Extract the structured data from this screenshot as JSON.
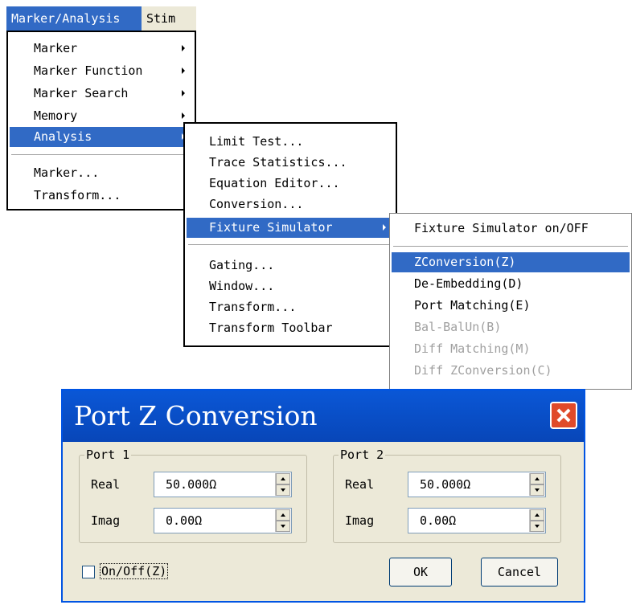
{
  "menubar": {
    "active_label": "Marker/Analysis",
    "next_label": "Stim"
  },
  "marker_menu": {
    "items": [
      "Marker",
      "Marker Function",
      "Marker Search",
      "Memory",
      "Analysis",
      "Marker...",
      "Transform..."
    ]
  },
  "analysis_menu": {
    "items": [
      "Limit Test...",
      "Trace Statistics...",
      "Equation Editor...",
      "Conversion...",
      "Fixture Simulator",
      "Gating...",
      "Window...",
      "Transform...",
      "Transform Toolbar"
    ]
  },
  "fixture_menu": {
    "items": [
      "Fixture Simulator on/OFF",
      "ZConversion(Z)",
      "De-Embedding(D)",
      "Port Matching(E)",
      "Bal-BalUn(B)",
      "Diff Matching(M)",
      "Diff ZConversion(C)"
    ]
  },
  "dialog": {
    "title": "Port Z Conversion",
    "port1": {
      "legend": "Port 1",
      "real_label": "Real",
      "real_value": "50.000Ω",
      "imag_label": "Imag",
      "imag_value": "0.00Ω"
    },
    "port2": {
      "legend": "Port 2",
      "real_label": "Real",
      "real_value": "50.000Ω",
      "imag_label": "Imag",
      "imag_value": "0.00Ω"
    },
    "onoff_label": "On/Off(Z)",
    "onoff_checked": false,
    "ok_label": "OK",
    "cancel_label": "Cancel"
  },
  "colors": {
    "highlight": "#316ac5",
    "titlebar": "#0a57d6",
    "close": "#e04a2a",
    "dialog_bg": "#ece9d8"
  }
}
